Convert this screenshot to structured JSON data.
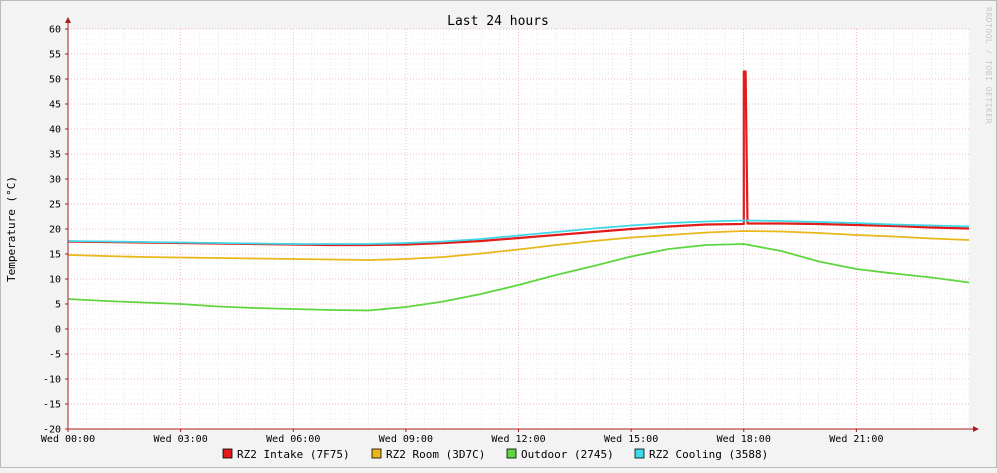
{
  "chart_data": {
    "type": "line",
    "title": "Last 24 hours",
    "ylabel": "Temperature (°C)",
    "xlabel": "",
    "watermark": "RRDTOOL / TOBI OETIKER",
    "ylim": [
      -20,
      60
    ],
    "xlim_hours": [
      0,
      24
    ],
    "x_tick_labels": [
      "Wed 00:00",
      "Wed 03:00",
      "Wed 06:00",
      "Wed 09:00",
      "Wed 12:00",
      "Wed 15:00",
      "Wed 18:00",
      "Wed 21:00"
    ],
    "x_tick_hours": [
      0,
      3,
      6,
      9,
      12,
      15,
      18,
      21
    ],
    "y_ticks": [
      -20,
      -15,
      -10,
      -5,
      0,
      5,
      10,
      15,
      20,
      25,
      30,
      35,
      40,
      45,
      50,
      55,
      60
    ],
    "grid": true,
    "legend_position": "bottom",
    "series": [
      {
        "name": "RZ2 Intake (7F75)",
        "color": "#e31b1b",
        "x_hours": [
          0,
          1,
          2,
          3,
          4,
          5,
          6,
          7,
          8,
          9,
          10,
          11,
          12,
          13,
          14,
          15,
          16,
          17,
          18,
          18.0,
          18.05,
          18.1,
          19,
          20,
          21,
          22,
          23,
          24
        ],
        "values": [
          17.5,
          17.4,
          17.3,
          17.2,
          17.1,
          17.0,
          16.9,
          16.8,
          16.8,
          16.9,
          17.2,
          17.6,
          18.2,
          18.8,
          19.4,
          20.0,
          20.5,
          20.9,
          21.0,
          51.5,
          51.5,
          21.1,
          21.1,
          21.0,
          20.8,
          20.6,
          20.3,
          20.1
        ]
      },
      {
        "name": "RZ2 Room (3D7C)",
        "color": "#e8b71a",
        "x_hours": [
          0,
          1,
          2,
          3,
          4,
          5,
          6,
          7,
          8,
          9,
          10,
          11,
          12,
          13,
          14,
          15,
          16,
          17,
          18,
          19,
          20,
          21,
          22,
          23,
          24
        ],
        "values": [
          14.8,
          14.6,
          14.4,
          14.3,
          14.2,
          14.1,
          14.0,
          13.9,
          13.8,
          14.0,
          14.4,
          15.1,
          15.9,
          16.8,
          17.6,
          18.3,
          18.8,
          19.3,
          19.6,
          19.5,
          19.2,
          18.8,
          18.5,
          18.1,
          17.8
        ]
      },
      {
        "name": "Outdoor (2745)",
        "color": "#5ed63f",
        "x_hours": [
          0,
          1,
          2,
          3,
          4,
          5,
          6,
          7,
          8,
          9,
          10,
          11,
          12,
          13,
          14,
          15,
          16,
          17,
          18,
          19,
          20,
          21,
          22,
          23,
          24
        ],
        "values": [
          6.0,
          5.6,
          5.3,
          5.0,
          4.5,
          4.2,
          4.0,
          3.8,
          3.7,
          4.4,
          5.5,
          7.0,
          8.8,
          10.8,
          12.6,
          14.5,
          16.0,
          16.8,
          17.0,
          15.6,
          13.5,
          12.0,
          11.1,
          10.3,
          9.3
        ]
      },
      {
        "name": "RZ2 Cooling (3588)",
        "color": "#3fd8e8",
        "x_hours": [
          0,
          1,
          2,
          3,
          4,
          5,
          6,
          7,
          8,
          9,
          10,
          11,
          12,
          13,
          14,
          15,
          16,
          17,
          18,
          19,
          20,
          21,
          22,
          23,
          24
        ],
        "values": [
          17.6,
          17.5,
          17.4,
          17.3,
          17.2,
          17.1,
          17.0,
          17.0,
          17.0,
          17.2,
          17.5,
          18.0,
          18.7,
          19.4,
          20.1,
          20.7,
          21.2,
          21.5,
          21.7,
          21.6,
          21.4,
          21.2,
          20.9,
          20.7,
          20.5
        ]
      }
    ]
  }
}
